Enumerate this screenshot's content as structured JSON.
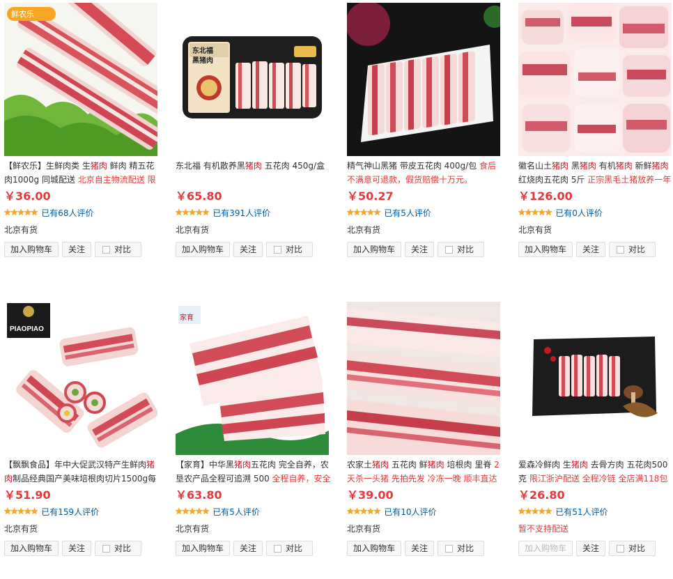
{
  "colors": {
    "price": "#e4393c",
    "highlight": "#c81623",
    "link": "#005aa0",
    "star": "#f5a623"
  },
  "buttons": {
    "add_cart": "加入购物车",
    "follow": "关注",
    "compare": "对比"
  },
  "products": [
    {
      "id": "p1",
      "name_parts": [
        {
          "t": "【鲜农乐】生鲜肉类 生"
        },
        {
          "t": "猪肉",
          "hl": true
        },
        {
          "t": " 鲜肉 精五花肉1000g 同城配送 "
        },
        {
          "t": "北京自主物流配送 限",
          "promo": true
        }
      ],
      "price": "￥36.00",
      "stars": "★★★★★",
      "reviews": "已有68人评价",
      "stock": "北京有货",
      "stock_status": "in",
      "image": {
        "badge": "鲜农乐",
        "icon": "pork-ribs-on-lettuce-image"
      }
    },
    {
      "id": "p2",
      "name_parts": [
        {
          "t": "东北福 有机散养黑"
        },
        {
          "t": "猪肉",
          "hl": true
        },
        {
          "t": " 五花肉 450g/盒"
        }
      ],
      "price": "￥65.80",
      "stars": "★★★★★",
      "reviews": "已有391人评价",
      "stock": "北京有货",
      "stock_status": "in",
      "image": {
        "label_line1": "东北福",
        "label_line2": "黑猪肉",
        "icon": "boxed-pork-belly-image"
      }
    },
    {
      "id": "p3",
      "name_parts": [
        {
          "t": "精气神山黑猪 带皮五花肉 400g/包 "
        },
        {
          "t": "食后不满意可退款，假货赔偿十万元。",
          "promo": true
        }
      ],
      "price": "￥50.27",
      "stars": "★★★★★",
      "reviews": "已有5人评价",
      "stock": "北京有货",
      "stock_status": "in",
      "image": {
        "icon": "pork-strips-on-plate-image"
      }
    },
    {
      "id": "p4",
      "name_parts": [
        {
          "t": "徽名山土"
        },
        {
          "t": "猪肉",
          "hl": true
        },
        {
          "t": " 黑"
        },
        {
          "t": "猪肉",
          "hl": true
        },
        {
          "t": " 有机"
        },
        {
          "t": "猪肉",
          "hl": true
        },
        {
          "t": " 新鲜"
        },
        {
          "t": "猪肉",
          "hl": true
        },
        {
          "t": " 红烧肉五花肉 5斤 "
        },
        {
          "t": "正宗黑毛土猪放养一年",
          "promo": true
        }
      ],
      "price": "￥126.00",
      "stars": "★★★★★",
      "reviews": "已有0人评价",
      "stock": "北京有货",
      "stock_status": "in",
      "image": {
        "icon": "pork-chunks-image"
      }
    },
    {
      "id": "p5",
      "name_parts": [
        {
          "t": "【飘飘食品】年中大促武汉特产生鲜肉"
        },
        {
          "t": "猪肉",
          "hl": true
        },
        {
          "t": "制品经典国产美味培根肉切片1500g每"
        }
      ],
      "price": "￥51.90",
      "stars": "★★★★★",
      "reviews": "已有159人评价",
      "stock": "北京有货",
      "stock_status": "in",
      "image": {
        "brand": "PIAOPIAO",
        "icon": "bacon-slices-image"
      }
    },
    {
      "id": "p6",
      "name_parts": [
        {
          "t": "【家育】中华黑"
        },
        {
          "t": "猪肉",
          "hl": true
        },
        {
          "t": "五花肉 完全自养，农垦农产品全程可追溯 500 "
        },
        {
          "t": "全程自养，安全",
          "promo": true
        }
      ],
      "price": "￥63.80",
      "stars": "★★★★★",
      "reviews": "已有5人评价",
      "stock": "北京有货",
      "stock_status": "in",
      "image": {
        "brand": "家育",
        "icon": "pork-belly-slabs-image"
      }
    },
    {
      "id": "p7",
      "name_parts": [
        {
          "t": "农家土"
        },
        {
          "t": "猪肉",
          "hl": true
        },
        {
          "t": " 五花肉 鲜"
        },
        {
          "t": "猪肉",
          "hl": true
        },
        {
          "t": " 培根肉 里脊 "
        },
        {
          "t": "2天杀一头猪 先拍先发 冷冻一晚 顺丰直达",
          "promo": true
        }
      ],
      "price": "￥39.00",
      "stars": "★★★★★",
      "reviews": "已有10人评价",
      "stock": "北京有货",
      "stock_status": "in",
      "image": {
        "icon": "long-pork-belly-image"
      }
    },
    {
      "id": "p8",
      "name_parts": [
        {
          "t": "爱森冷鲜肉 生"
        },
        {
          "t": "猪肉",
          "hl": true
        },
        {
          "t": " 去骨方肉 五花肉500克 "
        },
        {
          "t": "限江浙沪配送 全程冷链 全店满118包",
          "promo": true
        }
      ],
      "price": "￥26.80",
      "stars": "★★★★★",
      "reviews": "已有51人评价",
      "stock": "暂不支持配送",
      "stock_status": "out",
      "image": {
        "icon": "pork-on-black-board-image"
      }
    }
  ]
}
